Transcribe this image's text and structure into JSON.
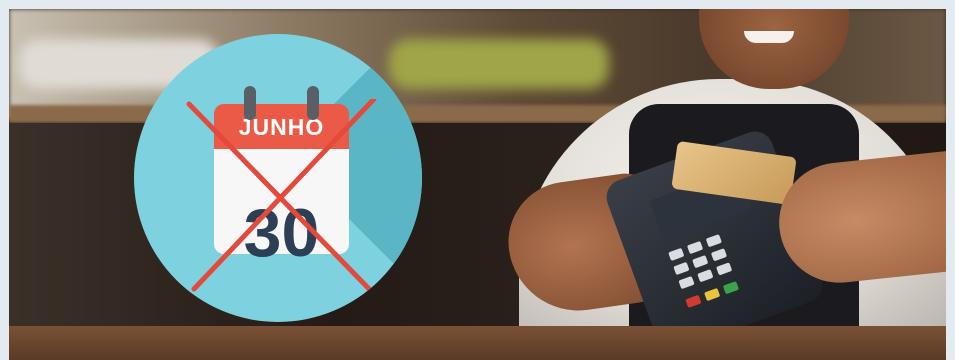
{
  "banner": {
    "calendar": {
      "month": "JUNHO",
      "day": "30",
      "crossed_out": true
    },
    "colors": {
      "page_background": "#e3ebf0",
      "badge_circle": "#7ed1de",
      "calendar_header": "#ea5a47",
      "calendar_day": "#2d3f55",
      "cross_mark": "#e24a3c"
    },
    "icons": [
      "calendar-icon",
      "cross-x-icon",
      "payment-terminal-icon",
      "credit-card-icon"
    ]
  }
}
